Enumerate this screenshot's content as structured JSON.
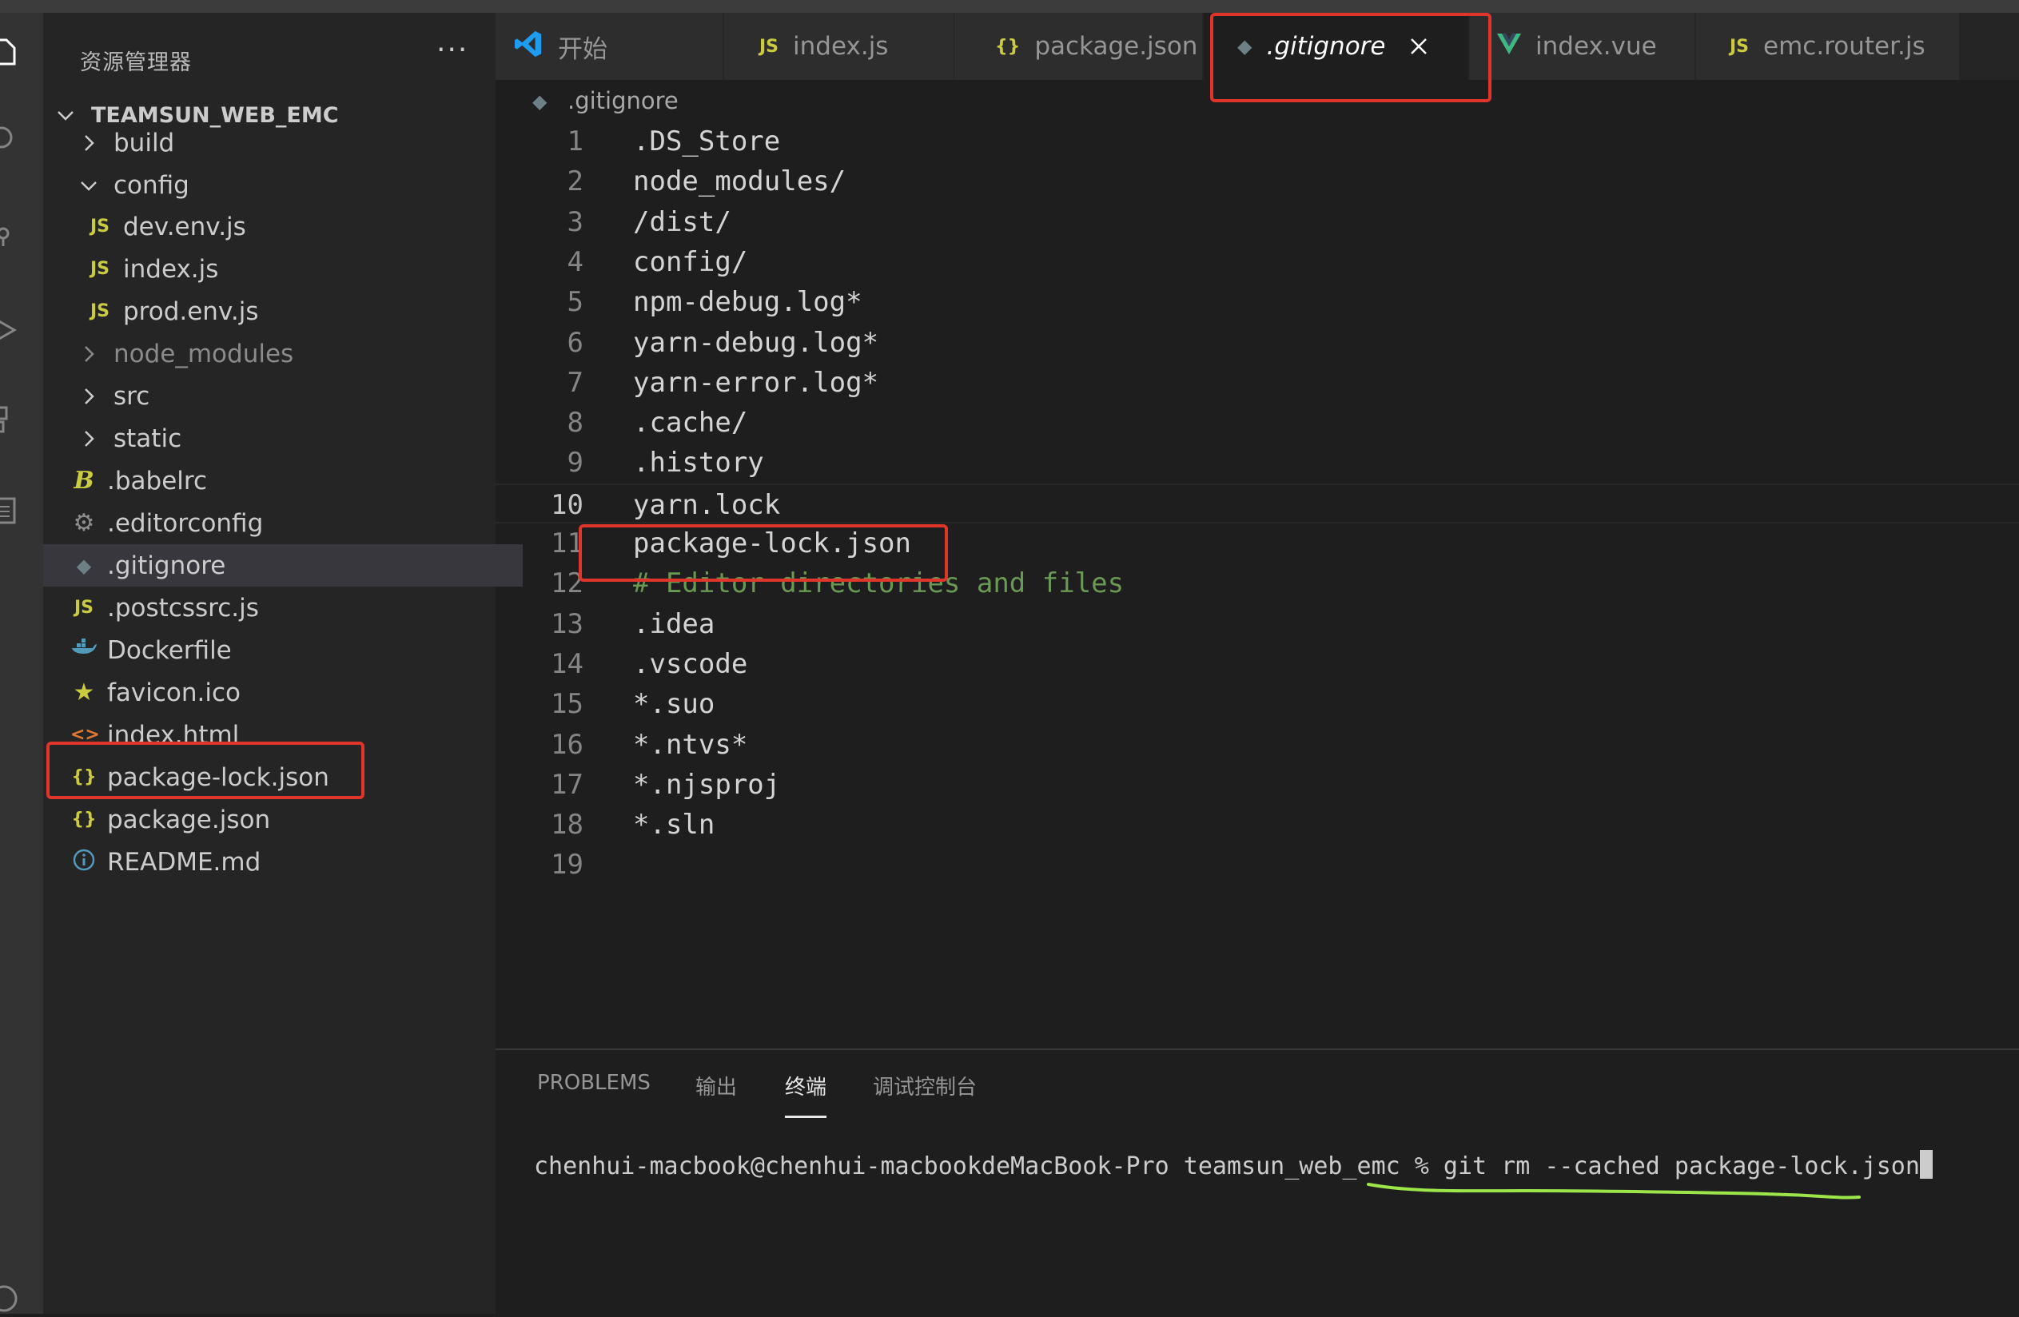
{
  "colors": {
    "js_icon": "#cbcb41",
    "json_icon": "#cbcb41",
    "vue_icon": "#41b883",
    "git_icon": "#6d8086",
    "html_icon": "#e37933",
    "info_icon": "#519aba",
    "docker_icon": "#519aba",
    "babel_icon": "#cbcb41",
    "star_icon": "#cbcb41",
    "vscode_blue": "#1f9cf0",
    "annotation_red": "#e0352b",
    "annotation_green": "#9de64a"
  },
  "sidebar": {
    "title": "资源管理器",
    "more": "···",
    "root": "TEAMSUN_WEB_EMC",
    "items": [
      {
        "label": "build",
        "icon": "chevron-right-icon"
      },
      {
        "label": "config",
        "icon": "chevron-down-icon"
      },
      {
        "label": "dev.env.js",
        "icon_text": "JS"
      },
      {
        "label": "index.js",
        "icon_text": "JS"
      },
      {
        "label": "prod.env.js",
        "icon_text": "JS"
      },
      {
        "label": "node_modules",
        "icon": "chevron-right-icon"
      },
      {
        "label": "src",
        "icon": "chevron-right-icon"
      },
      {
        "label": "static",
        "icon": "chevron-right-icon"
      },
      {
        "label": ".babelrc",
        "icon": "babel-icon"
      },
      {
        "label": ".editorconfig",
        "icon": "gear-icon"
      },
      {
        "label": ".gitignore",
        "icon": "git-icon"
      },
      {
        "label": ".postcssrc.js",
        "icon_text": "JS"
      },
      {
        "label": "Dockerfile",
        "icon": "docker-icon"
      },
      {
        "label": "favicon.ico",
        "icon": "star-icon"
      },
      {
        "label": "index.html",
        "icon_text": "<>"
      },
      {
        "label": "package-lock.json",
        "icon_text": "{}"
      },
      {
        "label": "package.json",
        "icon_text": "{}"
      },
      {
        "label": "README.md",
        "icon": "info-icon"
      }
    ]
  },
  "tabs": [
    {
      "label": "开始",
      "icon": "vscode-logo-icon"
    },
    {
      "label": "index.js",
      "icon_text": "JS"
    },
    {
      "label": "package.json",
      "icon_text": "{}"
    },
    {
      "label": ".gitignore",
      "icon": "git-icon"
    },
    {
      "label": "index.vue",
      "icon": "vue-icon"
    },
    {
      "label": "emc.router.js",
      "icon_text": "JS"
    }
  ],
  "breadcrumb": ".gitignore",
  "editor": {
    "current_line": 10,
    "lines": [
      {
        "n": "1",
        "text": ".DS_Store"
      },
      {
        "n": "2",
        "text": "node_modules/"
      },
      {
        "n": "3",
        "text": "/dist/"
      },
      {
        "n": "4",
        "text": "config/"
      },
      {
        "n": "5",
        "text": "npm-debug.log*"
      },
      {
        "n": "6",
        "text": "yarn-debug.log*"
      },
      {
        "n": "7",
        "text": "yarn-error.log*"
      },
      {
        "n": "8",
        "text": ".cache/"
      },
      {
        "n": "9",
        "text": ".history"
      },
      {
        "n": "10",
        "text": "yarn.lock"
      },
      {
        "n": "11",
        "text": "package-lock.json"
      },
      {
        "n": "12",
        "text": "# Editor directories and files"
      },
      {
        "n": "13",
        "text": ".idea"
      },
      {
        "n": "14",
        "text": ".vscode"
      },
      {
        "n": "15",
        "text": "*.suo"
      },
      {
        "n": "16",
        "text": "*.ntvs*"
      },
      {
        "n": "17",
        "text": "*.njsproj"
      },
      {
        "n": "18",
        "text": "*.sln"
      },
      {
        "n": "19",
        "text": ""
      }
    ]
  },
  "panel": {
    "tabs": [
      "PROBLEMS",
      "输出",
      "终端",
      "调试控制台"
    ],
    "active_tab": "终端",
    "prompt": "chenhui-macbook@chenhui-macbookdeMacBook-Pro teamsun_web_emc % ",
    "command": "git rm --cached package-lock.json"
  }
}
